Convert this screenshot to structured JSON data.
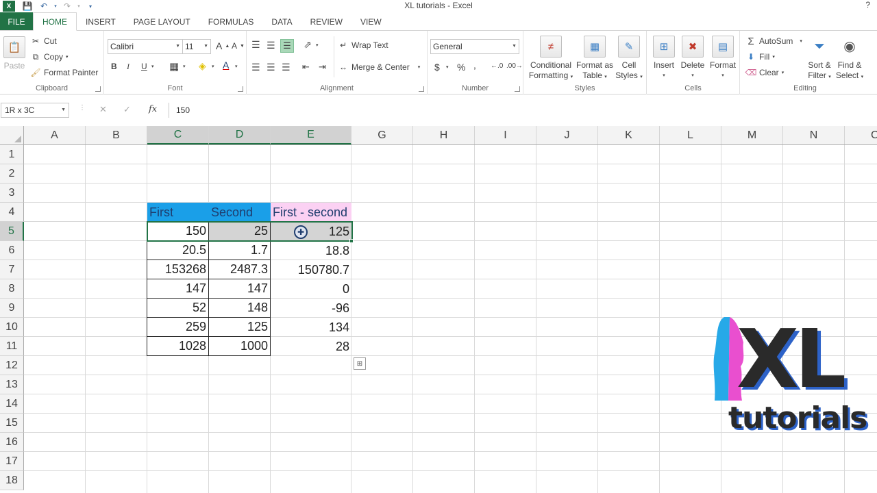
{
  "window": {
    "title": "XL tutorials - Excel",
    "help": "?"
  },
  "qat": {
    "logo": "X",
    "save_icon": "save-icon",
    "undo_icon": "undo-icon",
    "redo_icon": "redo-icon"
  },
  "tabs": [
    "FILE",
    "HOME",
    "INSERT",
    "PAGE LAYOUT",
    "FORMULAS",
    "DATA",
    "REVIEW",
    "VIEW"
  ],
  "active_tab": "HOME",
  "ribbon": {
    "clipboard": {
      "label": "Clipboard",
      "paste": "Paste",
      "cut": "Cut",
      "copy": "Copy",
      "format_painter": "Format Painter"
    },
    "font": {
      "label": "Font",
      "family": "Calibri",
      "size": "11",
      "bold": "B",
      "italic": "I",
      "underline": "U"
    },
    "alignment": {
      "label": "Alignment",
      "wrap_text": "Wrap Text",
      "merge_center": "Merge & Center"
    },
    "number": {
      "label": "Number",
      "format": "General",
      "currency": "$",
      "percent": "%",
      "comma": "̩"
    },
    "styles": {
      "label": "Styles",
      "conditional_1": "Conditional",
      "conditional_2": "Formatting",
      "format_table_1": "Format as",
      "format_table_2": "Table",
      "cell_styles_1": "Cell",
      "cell_styles_2": "Styles"
    },
    "cells": {
      "label": "Cells",
      "insert": "Insert",
      "delete": "Delete",
      "format": "Format"
    },
    "editing": {
      "label": "Editing",
      "autosum": "AutoSum",
      "fill": "Fill",
      "clear": "Clear",
      "sort_1": "Sort &",
      "sort_2": "Filter",
      "find_1": "Find &",
      "find_2": "Select"
    }
  },
  "formula_bar": {
    "name_box": "1R x 3C",
    "cancel": "✕",
    "enter": "✓",
    "fx": "fx",
    "value": "150"
  },
  "columns": [
    "A",
    "B",
    "C",
    "D",
    "E",
    "G",
    "H",
    "I",
    "J",
    "K",
    "L",
    "M",
    "N",
    "C"
  ],
  "rows": [
    "1",
    "2",
    "3",
    "4",
    "5",
    "6",
    "7",
    "8",
    "9",
    "10",
    "11",
    "12",
    "13",
    "14",
    "15",
    "16",
    "17",
    "18"
  ],
  "table": {
    "headers": [
      "First",
      "Second",
      "First - second"
    ],
    "data": [
      [
        "150",
        "25",
        "125"
      ],
      [
        "20.5",
        "1.7",
        "18.8"
      ],
      [
        "153268",
        "2487.3",
        "150780.7"
      ],
      [
        "147",
        "147",
        "0"
      ],
      [
        "52",
        "148",
        "-96"
      ],
      [
        "259",
        "125",
        "134"
      ],
      [
        "1028",
        "1000",
        "28"
      ]
    ]
  },
  "logo": {
    "main": "XL",
    "sub": "tutorials"
  },
  "colors": {
    "accent": "#217346",
    "header_blue": "#1a9fe8",
    "header_pink": "#fbd1f3"
  }
}
